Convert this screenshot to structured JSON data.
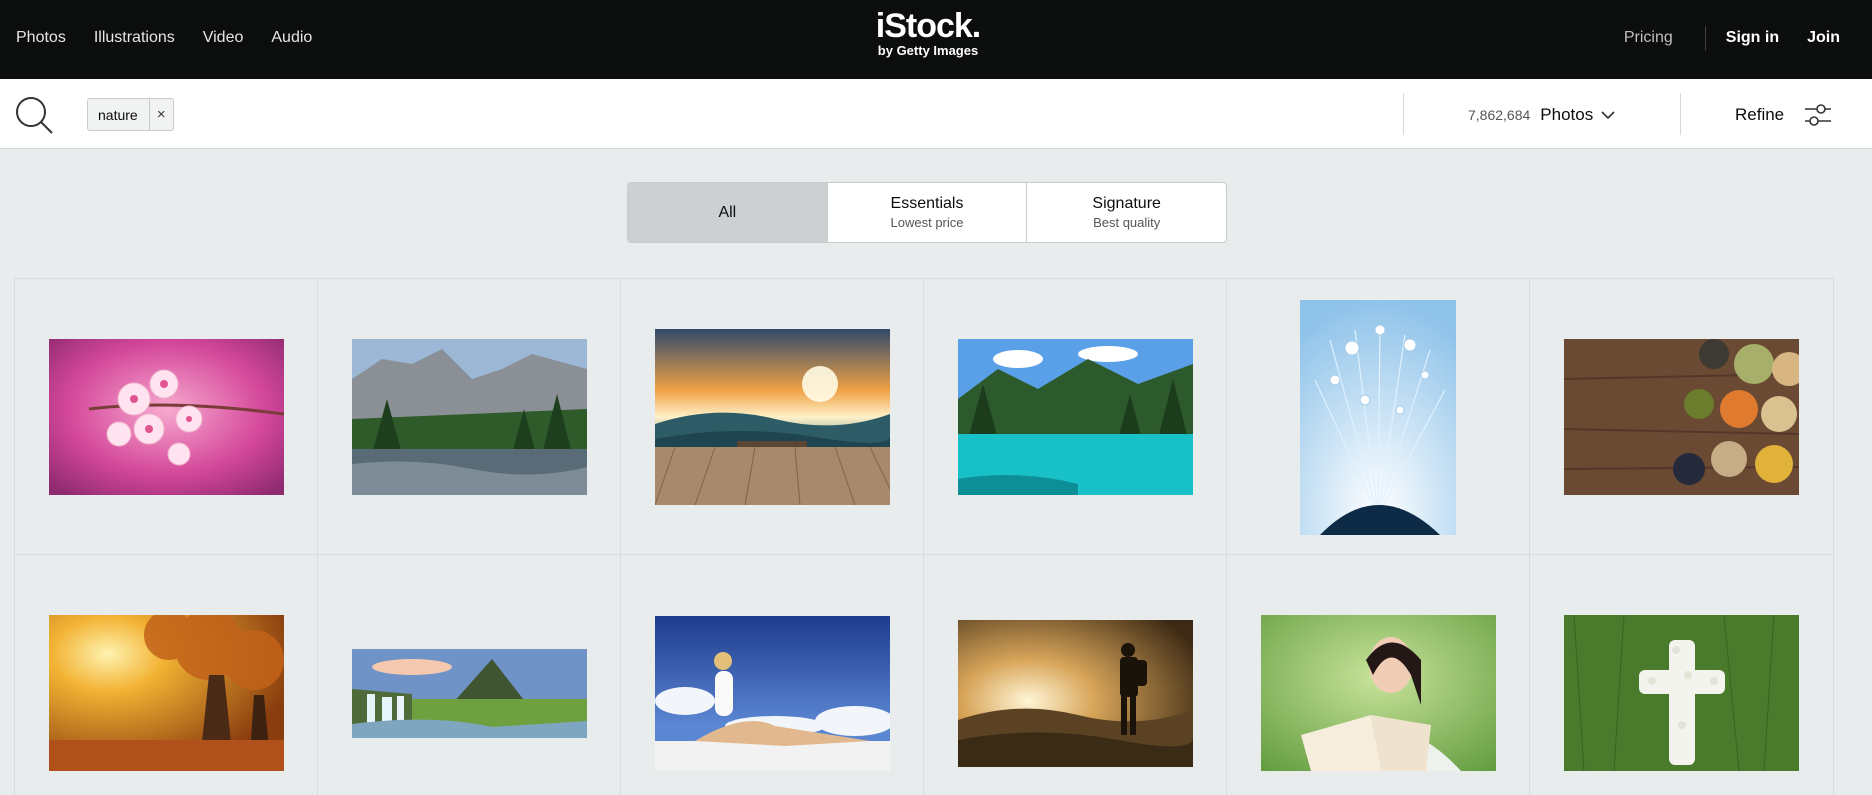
{
  "nav": {
    "links": [
      "Photos",
      "Illustrations",
      "Video",
      "Audio"
    ],
    "logo_main": "iStock.",
    "logo_sub": "by Getty Images",
    "pricing": "Pricing",
    "signin": "Sign in",
    "join": "Join"
  },
  "search": {
    "chip_label": "nature",
    "chip_remove": "×",
    "result_count": "7,862,684",
    "media_type": "Photos",
    "refine_label": "Refine"
  },
  "filters": [
    {
      "title": "All",
      "sub": ""
    },
    {
      "title": "Essentials",
      "sub": "Lowest price"
    },
    {
      "title": "Signature",
      "sub": "Best quality"
    }
  ],
  "images": [
    {
      "name": "cherry-blossom-photo"
    },
    {
      "name": "yosemite-river-photo"
    },
    {
      "name": "sunset-deck-photo"
    },
    {
      "name": "turquoise-lake-photo"
    },
    {
      "name": "dandelion-dew-photo"
    },
    {
      "name": "legumes-bowls-photo"
    },
    {
      "name": "autumn-tree-photo"
    },
    {
      "name": "waterfall-mountain-photo"
    },
    {
      "name": "woman-beach-photo"
    },
    {
      "name": "hiker-sunrise-photo"
    },
    {
      "name": "woman-reading-photo"
    },
    {
      "name": "flower-cross-grass-photo"
    }
  ],
  "colors": {
    "nav_bg": "#0c0d0d",
    "page_bg": "#e9eced",
    "active_filter_bg": "#ccd0d2"
  }
}
